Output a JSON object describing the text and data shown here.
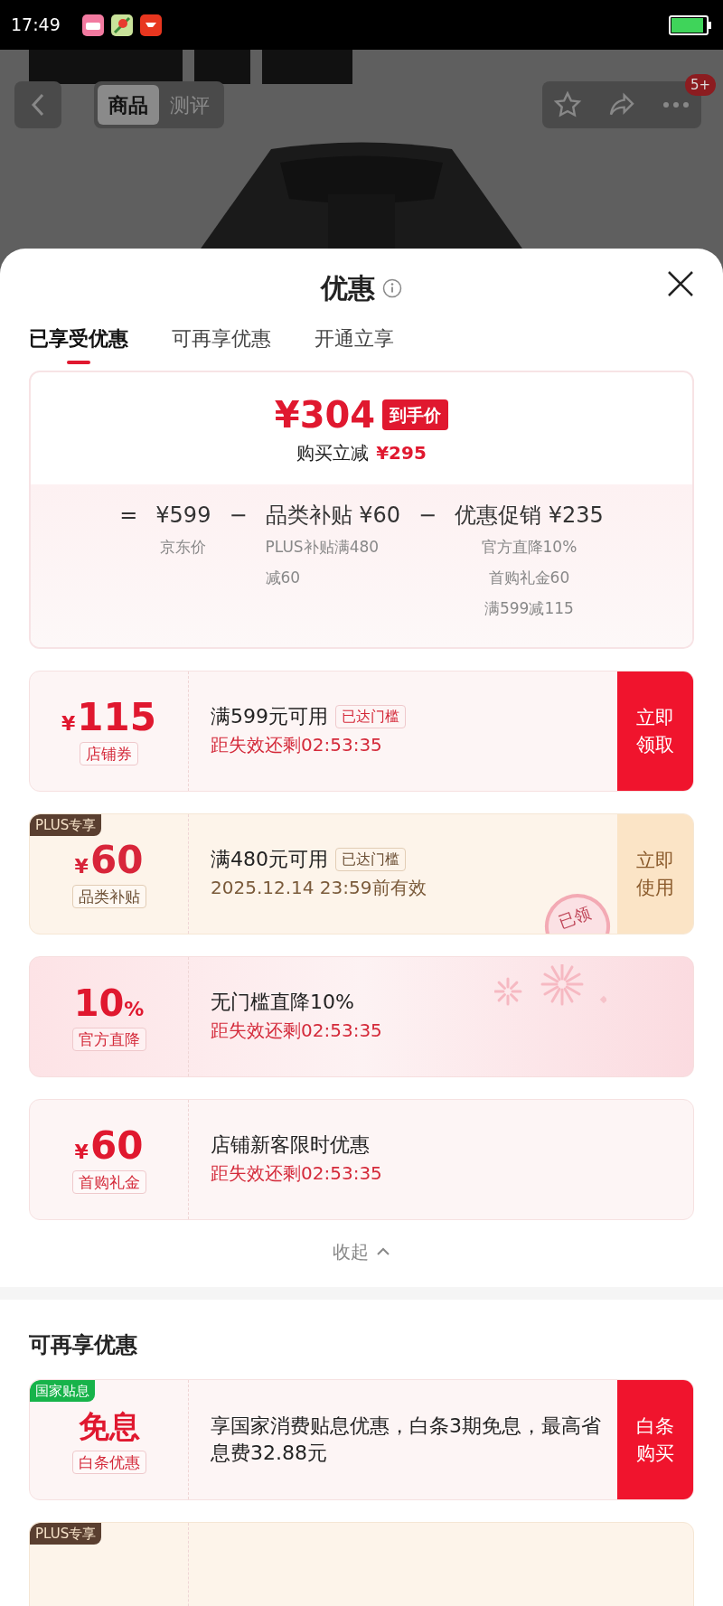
{
  "status_bar": {
    "time": "17:49"
  },
  "product_nav": {
    "tabs": [
      {
        "label": "商品",
        "selected": true
      },
      {
        "label": "测评",
        "selected": false
      }
    ],
    "badge": "5+"
  },
  "sheet": {
    "title": "优惠",
    "tabs": [
      {
        "label": "已享受优惠",
        "selected": true
      },
      {
        "label": "可再享优惠",
        "selected": false
      },
      {
        "label": "开通立享",
        "selected": false
      }
    ],
    "summary": {
      "price": "¥304",
      "price_badge": "到手价",
      "saving_label": "购买立减",
      "saving": "¥295",
      "formula": [
        {
          "op": "=",
          "value": "¥599",
          "notes": [
            "京东价"
          ]
        },
        {
          "op": "−",
          "value": "品类补贴 ¥60",
          "notes": [
            "PLUS补贴满480减60"
          ]
        },
        {
          "op": "−",
          "value": "优惠促销 ¥235",
          "notes": [
            "官方直降10%",
            "首购礼金60",
            "满599减115"
          ]
        }
      ]
    },
    "coupons": [
      {
        "kind": "red",
        "currency": "¥",
        "amount": "115",
        "label": "店铺券",
        "title": "满599元可用",
        "threshold": "已达门槛",
        "subtitle": "距失效还剩02:53:35",
        "action": "立即领取"
      },
      {
        "kind": "gold",
        "tag": {
          "kind": "plus",
          "text": "PLUS专享"
        },
        "currency": "¥",
        "amount": "60",
        "label": "品类补贴",
        "title": "满480元可用",
        "threshold": "已达门槛",
        "subtitle": "2025.12.14 23:59前有效",
        "action": "立即使用",
        "stamp": "已领"
      },
      {
        "kind": "pink",
        "amount": "10",
        "unit": "%",
        "label": "官方直降",
        "title": "无门槛直降10%",
        "subtitle": "距失效还剩02:53:35"
      },
      {
        "kind": "red",
        "currency": "¥",
        "amount": "60",
        "label": "首购礼金",
        "title": "店铺新客限时优惠",
        "subtitle": "距失效还剩02:53:35"
      }
    ],
    "collapse": "收起",
    "more_title": "可再享优惠",
    "more_coupons": [
      {
        "kind": "red",
        "tag": {
          "kind": "green",
          "text": "国家贴息"
        },
        "amount": "免息",
        "label": "白条优惠",
        "title": "享国家消费贴息优惠，白条3期免息，最高省息费32.88元",
        "action": "白条购买"
      },
      {
        "kind": "gold",
        "tag": {
          "kind": "plus",
          "text": "PLUS专享"
        }
      }
    ]
  }
}
